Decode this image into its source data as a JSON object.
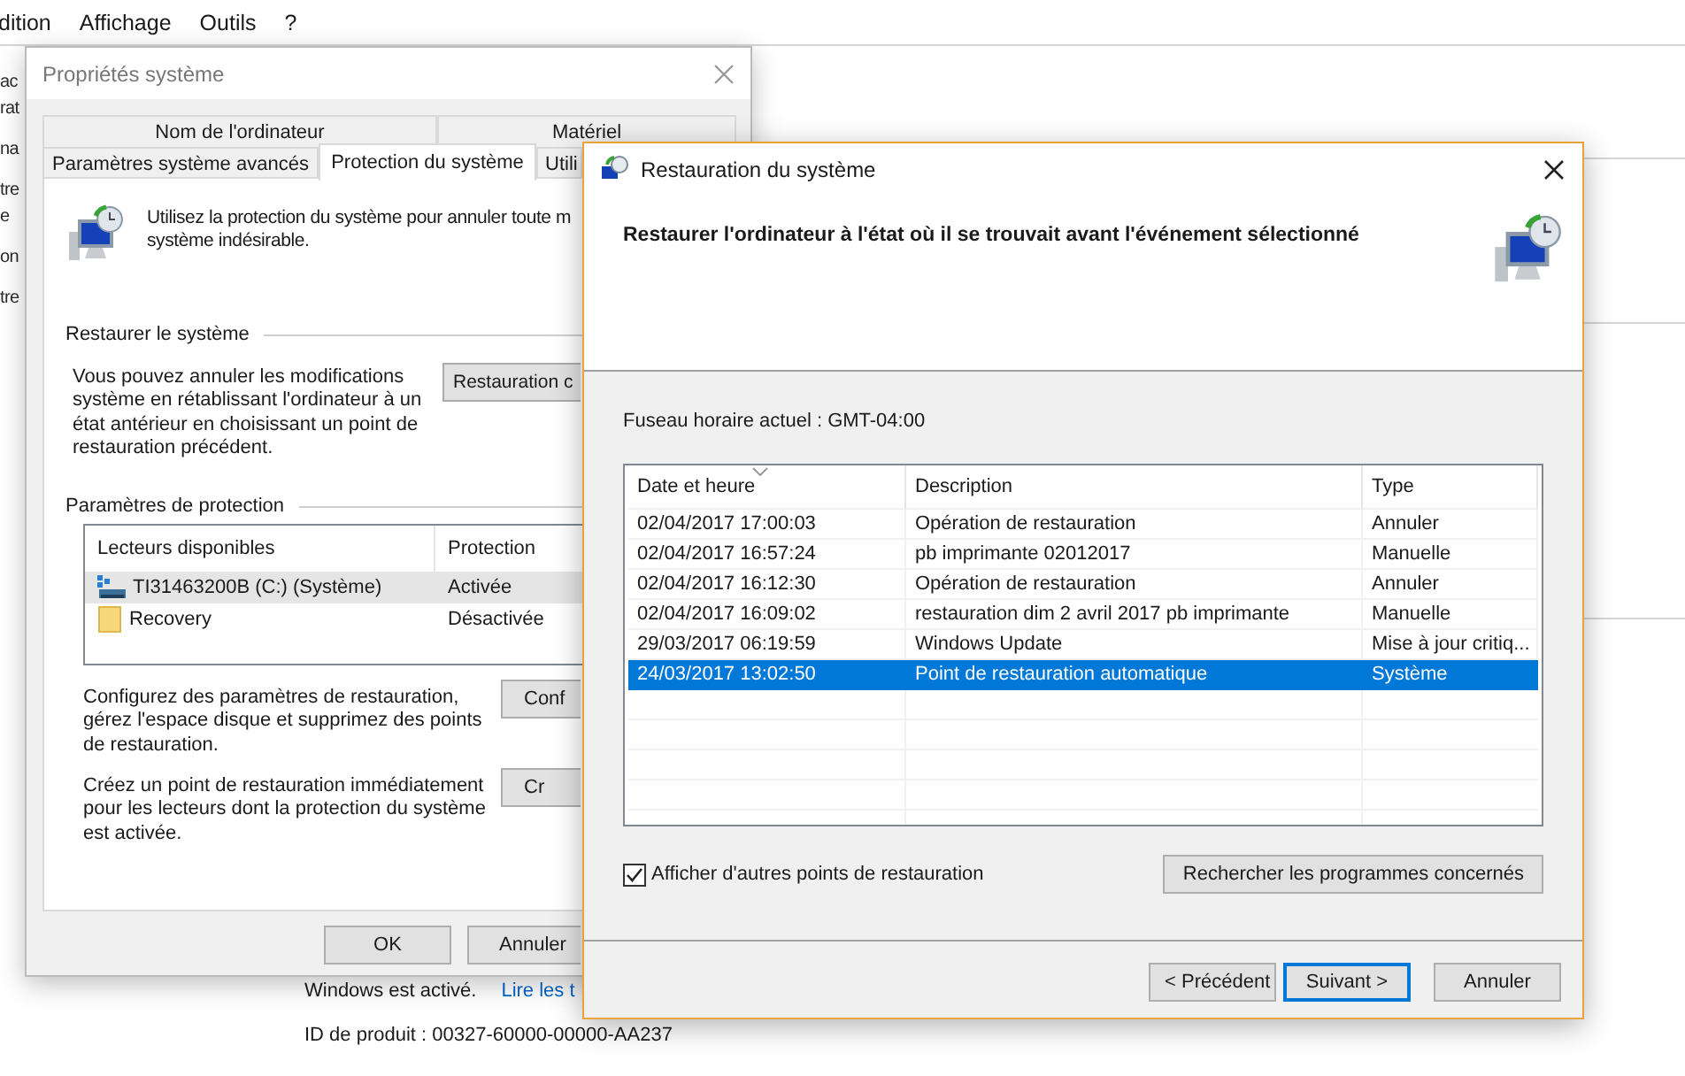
{
  "background_window": {
    "menu": [
      "dition",
      "Affichage",
      "Outils",
      "?"
    ],
    "side_fragments": [
      [
        "ac",
        "rat"
      ],
      [
        "na"
      ],
      [
        "tre",
        "e"
      ],
      [
        "on"
      ],
      [
        "tre"
      ]
    ],
    "status": {
      "activation": "Windows est activé.",
      "link": "Lire les t",
      "product_id": "ID de produit : 00327-60000-00000-AA237"
    }
  },
  "system_properties": {
    "title": "Propriétés système",
    "tabs_top": [
      {
        "label": "Nom de l'ordinateur",
        "selected": false
      },
      {
        "label": "Matériel",
        "selected": false
      }
    ],
    "tabs": [
      {
        "label": "Paramètres système avancés",
        "selected": false
      },
      {
        "label": "Protection du système",
        "selected": true
      },
      {
        "label": "Utili",
        "selected": false
      }
    ],
    "intro_lines": [
      "Utilisez la protection du système pour annuler toute m",
      "système indésirable."
    ],
    "restore_group": {
      "label": "Restaurer le système",
      "text": "Vous pouvez annuler les modifications système en rétablissant l'ordinateur à un état antérieur en choisissant un point de restauration précédent.",
      "button": "Restauration c"
    },
    "protection_group": {
      "label": "Paramètres de protection",
      "columns": [
        "Lecteurs disponibles",
        "Protection"
      ],
      "rows": [
        {
          "kind": "drive",
          "name": "TI31463200B (C:) (Système)",
          "protection": "Activée",
          "selected": true
        },
        {
          "kind": "folder",
          "name": "Recovery",
          "protection": "Désactivée",
          "selected": false
        }
      ]
    },
    "actions": [
      {
        "text": "Configurez des paramètres de restauration, gérez l'espace disque et supprimez des points de restauration.",
        "button": "Conf"
      },
      {
        "text": "Créez un point de restauration immédiatement pour les lecteurs dont la protection du système est activée.",
        "button": "Cr"
      }
    ],
    "buttons": [
      "OK",
      "Annuler"
    ]
  },
  "restore_wizard": {
    "title": "Restauration du système",
    "heading": "Restaurer l'ordinateur à l'état où il se trouvait avant l'événement sélectionné",
    "timezone": "Fuseau horaire actuel : GMT-04:00",
    "columns": [
      "Date et heure",
      "Description",
      "Type"
    ],
    "rows": [
      {
        "date": "02/04/2017 17:00:03",
        "description": "Opération de restauration",
        "type": "Annuler",
        "selected": false
      },
      {
        "date": "02/04/2017 16:57:24",
        "description": "pb imprimante 02012017",
        "type": "Manuelle",
        "selected": false
      },
      {
        "date": "02/04/2017 16:12:30",
        "description": "Opération de restauration",
        "type": "Annuler",
        "selected": false
      },
      {
        "date": "02/04/2017 16:09:02",
        "description": "restauration dim 2 avril 2017 pb imprimante",
        "type": "Manuelle",
        "selected": false
      },
      {
        "date": "29/03/2017 06:19:59",
        "description": "Windows Update",
        "type": "Mise à jour critiq...",
        "selected": false
      },
      {
        "date": "24/03/2017 13:02:50",
        "description": "Point de restauration automatique",
        "type": "Système",
        "selected": true
      }
    ],
    "show_more": {
      "label": "Afficher d'autres points de restauration",
      "checked": true
    },
    "scan_button": "Rechercher les programmes concernés",
    "nav_buttons": [
      {
        "label": "< Précédent",
        "default": false
      },
      {
        "label": "Suivant >",
        "default": true
      },
      {
        "label": "Annuler",
        "default": false
      }
    ]
  }
}
